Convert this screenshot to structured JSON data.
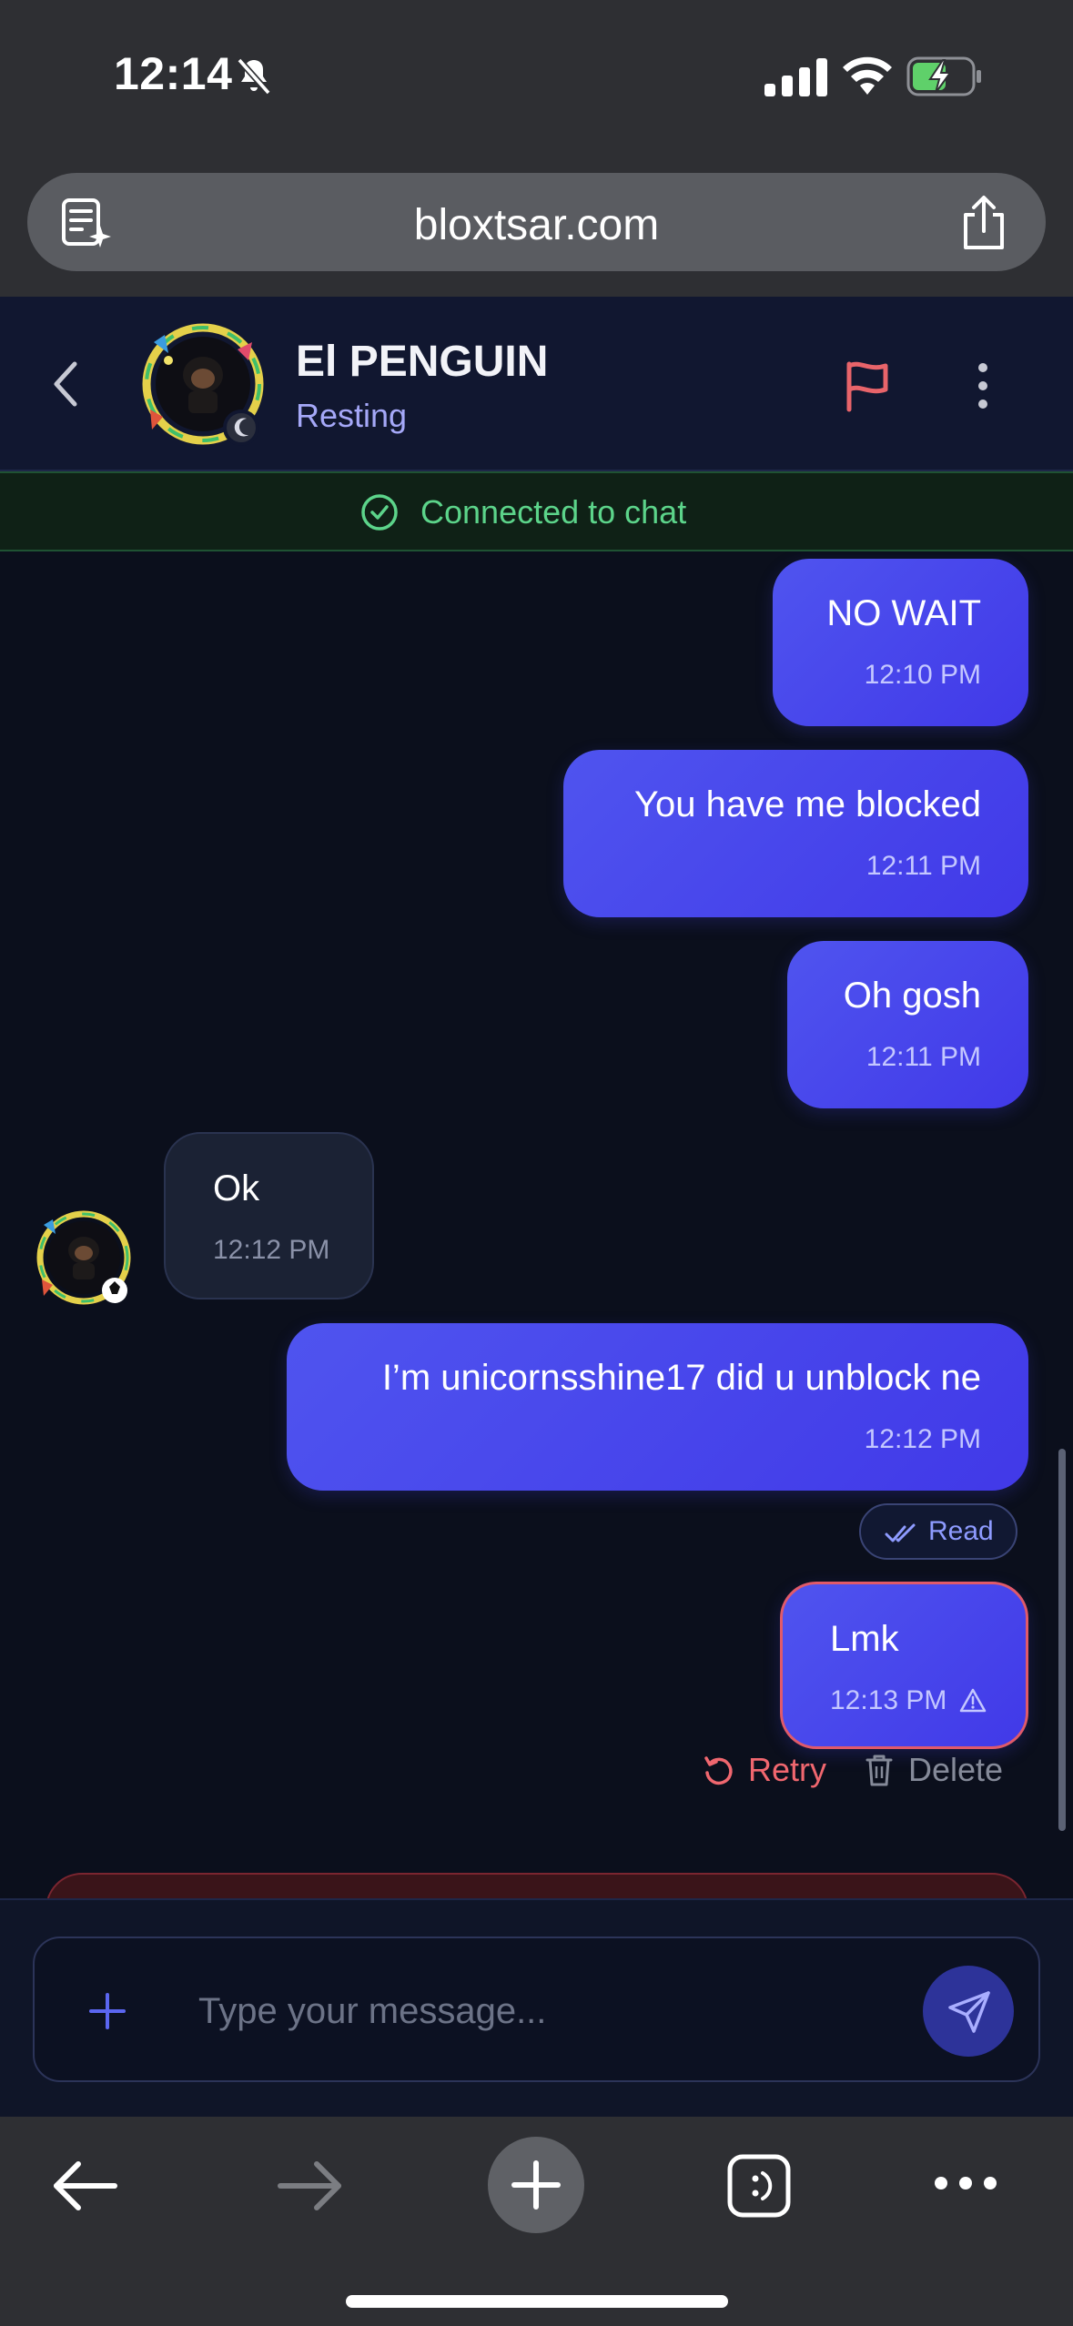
{
  "status_bar": {
    "time": "12:14"
  },
  "browser": {
    "url": "bloxtsar.com"
  },
  "chat_header": {
    "contact_name": "El PENGUIN",
    "contact_status": "Resting"
  },
  "connection": {
    "text": "Connected to chat"
  },
  "messages": [
    {
      "sender": "me",
      "text": "NO WAIT",
      "time": "12:10 PM"
    },
    {
      "sender": "me",
      "text": "You have me blocked",
      "time": "12:11 PM"
    },
    {
      "sender": "me",
      "text": "Oh gosh",
      "time": "12:11 PM"
    },
    {
      "sender": "them",
      "text": "Ok",
      "time": "12:12 PM"
    },
    {
      "sender": "me",
      "text": "I’m unicornsshine17 did u unblock ne",
      "time": "12:12 PM"
    },
    {
      "sender": "me",
      "text": "Lmk",
      "time": "12:13 PM",
      "status": "failed"
    }
  ],
  "read_receipt": "Read",
  "failed_actions": {
    "retry": "Retry",
    "delete": "Delete"
  },
  "composer": {
    "placeholder": "Type your message..."
  },
  "colors": {
    "accent": "#4f54ef",
    "online_green": "#5cd48a",
    "error_red": "#f0676f",
    "flag_red": "#e8646a"
  },
  "icons": {
    "status_bar": [
      "bell-slash-icon",
      "cellular-signal-icon",
      "wifi-icon",
      "battery-charging-icon"
    ],
    "browser": [
      "reader-icon",
      "share-icon"
    ],
    "header": [
      "chevron-left-icon",
      "flag-icon",
      "more-vertical-icon"
    ],
    "toolbar": [
      "arrow-left-icon",
      "arrow-right-icon",
      "plus-icon",
      "tabs-icon",
      "ellipsis-icon"
    ]
  }
}
